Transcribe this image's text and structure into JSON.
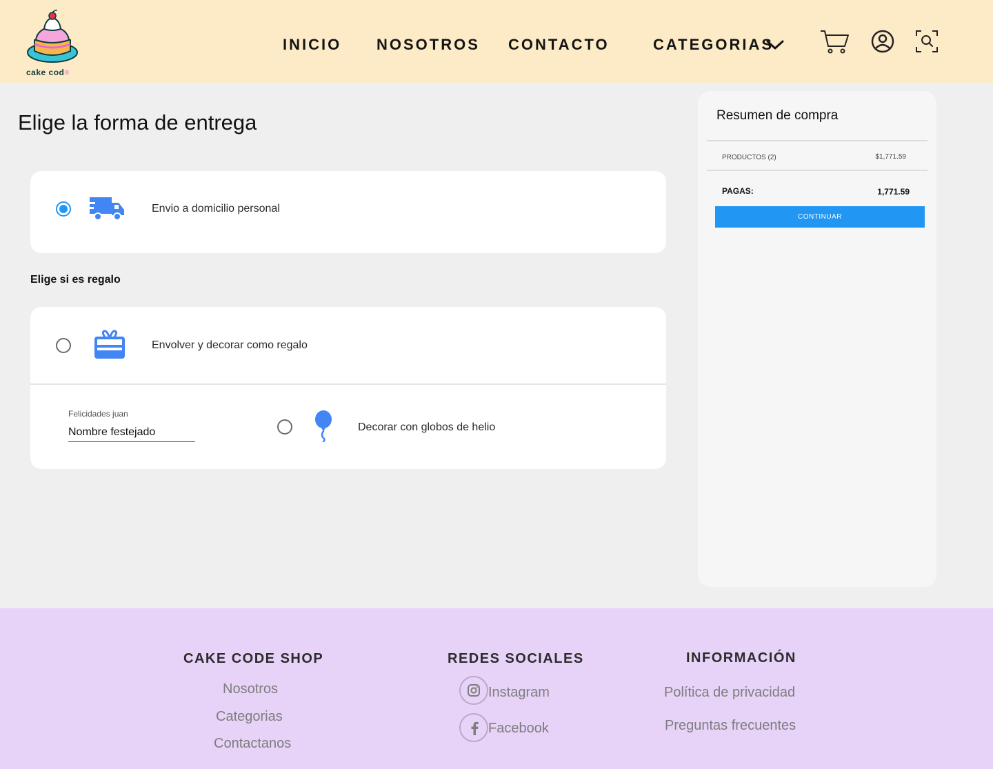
{
  "brand": {
    "logo_text": "cake cod",
    "logo_suffix": "≡"
  },
  "nav": {
    "inicio": "INICIO",
    "nosotros": "NOSOTROS",
    "contacto": "CONTACTO",
    "categorias": "CATEGORIAS"
  },
  "icons": {
    "header": [
      "chevron-down-icon",
      "cart-icon",
      "user-icon",
      "search-scan-icon"
    ],
    "delivery": "truck-icon",
    "gift": "gift-box-icon",
    "balloon": "balloon-icon",
    "instagram": "instagram-icon",
    "facebook": "facebook-icon"
  },
  "main": {
    "title": "Elige la forma de entrega",
    "delivery_option": {
      "label": "Envio a domicilio personal",
      "selected": true
    },
    "gift_section_title": "Elige si es regalo",
    "gift_option": {
      "label": "Envolver y decorar como regalo",
      "selected": false
    },
    "name_field": {
      "caption": "Felicidades juan",
      "value": "Nombre festejado"
    },
    "balloon_option": {
      "label": "Decorar con globos de helio",
      "selected": false
    }
  },
  "summary": {
    "title": "Resumen de compra",
    "products_label": "PRODUCTOS (2)",
    "products_value": "$1,771.59",
    "pay_label": "PAGAS:",
    "pay_value": "1,771.59",
    "continue_label": "CONTINUAR"
  },
  "footer": {
    "col1": {
      "title": "CAKE CODE SHOP",
      "links": [
        "Nosotros",
        "Categorias",
        "Contactanos"
      ]
    },
    "col2": {
      "title": "REDES SOCIALES",
      "links": [
        "Instagram",
        "Facebook"
      ]
    },
    "col3": {
      "title": "INFORMACIÓN",
      "links": [
        "Política de privacidad",
        "Preguntas frecuentes"
      ]
    }
  },
  "colors": {
    "header_bg": "#fdebc8",
    "page_bg": "#efefef",
    "accent_blue": "#2196f3",
    "icon_blue": "#4285f4",
    "footer_bg": "#e7d2f8"
  }
}
